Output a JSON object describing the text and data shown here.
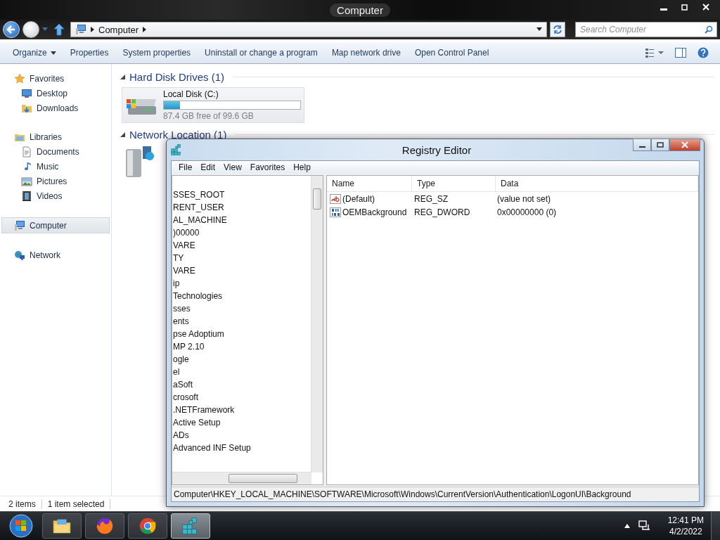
{
  "explorer": {
    "title": "Computer",
    "breadcrumb": [
      "Computer"
    ],
    "search": {
      "placeholder": "Search Computer"
    },
    "toolbar": [
      {
        "label": "Organize",
        "dropdown": true
      },
      {
        "label": "Properties",
        "dropdown": false
      },
      {
        "label": "System properties",
        "dropdown": false
      },
      {
        "label": "Uninstall or change a program",
        "dropdown": false
      },
      {
        "label": "Map network drive",
        "dropdown": false
      },
      {
        "label": "Open Control Panel",
        "dropdown": false
      }
    ],
    "nav": [
      {
        "label": "Favorites",
        "kind": "star",
        "selected": false,
        "children": [
          {
            "label": "Desktop",
            "kind": "desktop",
            "selected": false
          },
          {
            "label": "Downloads",
            "kind": "folder",
            "selected": false
          }
        ]
      },
      {
        "label": "Libraries",
        "kind": "library",
        "selected": false,
        "children": [
          {
            "label": "Documents",
            "kind": "document",
            "selected": false
          },
          {
            "label": "Music",
            "kind": "music",
            "selected": false
          },
          {
            "label": "Pictures",
            "kind": "pictures",
            "selected": false
          },
          {
            "label": "Videos",
            "kind": "video",
            "selected": false
          }
        ]
      },
      {
        "label": "Computer",
        "kind": "computer",
        "selected": true
      },
      {
        "label": "Network",
        "kind": "network",
        "selected": false
      }
    ],
    "sections": [
      {
        "title": "Hard Disk Drives (1)",
        "kind": "drives",
        "drives": [
          {
            "name": "Local Disk (C:)",
            "level": 0.12,
            "free": "87.4 GB free of 99.6 GB"
          }
        ]
      },
      {
        "title": "Network Location (1)",
        "kind": "network"
      }
    ],
    "status": [
      "2 items",
      "1 item selected"
    ]
  },
  "regedit": {
    "title": "Registry Editor",
    "menu": [
      "File",
      "Edit",
      "View",
      "Favorites",
      "Help"
    ],
    "tree": [
      {
        "label": "SSES_ROOT"
      },
      {
        "label": "RENT_USER"
      },
      {
        "label": "AL_MACHINE"
      },
      {
        "label": ")00000"
      },
      {
        "label": "VARE"
      },
      {
        "label": "TY"
      },
      {
        "label": "VARE"
      },
      {
        "label": "ip"
      },
      {
        "label": "Technologies"
      },
      {
        "label": "sses"
      },
      {
        "label": "ents"
      },
      {
        "label": "pse Adoptium"
      },
      {
        "label": "MP 2.10"
      },
      {
        "label": "ogle"
      },
      {
        "label": "el"
      },
      {
        "label": "aSoft"
      },
      {
        "label": "crosoft"
      },
      {
        "label": ".NETFramework"
      },
      {
        "label": "Active Setup"
      },
      {
        "label": "ADs"
      },
      {
        "label": "Advanced INF Setup"
      }
    ],
    "columns": [
      "Name",
      "Type",
      "Data"
    ],
    "rows": [
      {
        "kind": "string",
        "name": "(Default)",
        "type": "REG_SZ",
        "data": "(value not set)"
      },
      {
        "kind": "binary",
        "name": "OEMBackground",
        "type": "REG_DWORD",
        "data": "0x00000000 (0)"
      }
    ],
    "path": "Computer\\HKEY_LOCAL_MACHINE\\SOFTWARE\\Microsoft\\Windows\\CurrentVersion\\Authentication\\LogonUI\\Background"
  },
  "taskbar": {
    "apps": [
      {
        "kind": "explorer",
        "selected": false
      },
      {
        "kind": "firefox",
        "selected": false
      },
      {
        "kind": "chrome",
        "selected": false
      },
      {
        "kind": "regedit",
        "selected": true
      }
    ],
    "time": "12:41 PM",
    "date": "4/2/2022"
  }
}
